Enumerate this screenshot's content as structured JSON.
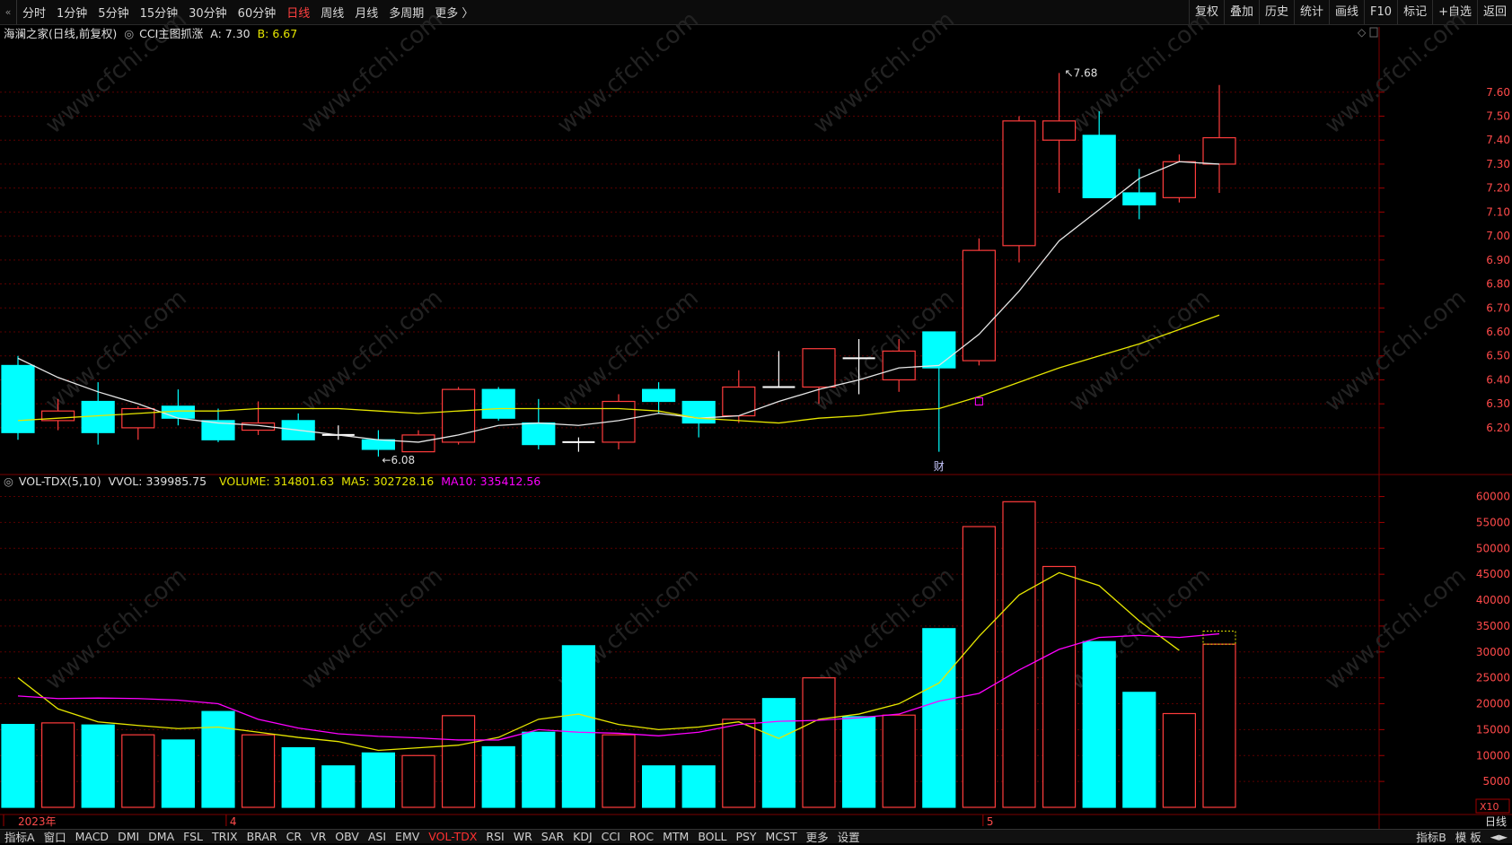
{
  "toolbar": {
    "collapse_icon": "double-chevron-icon",
    "periods": [
      "分时",
      "1分钟",
      "5分钟",
      "15分钟",
      "30分钟",
      "60分钟",
      "日线",
      "周线",
      "月线",
      "多周期",
      "更多 〉"
    ],
    "active_period": "日线",
    "right_tools": [
      "复权",
      "叠加",
      "历史",
      "统计",
      "画线",
      "F10",
      "标记",
      "+自选",
      "返回"
    ]
  },
  "main_info": {
    "stock": "海澜之家(日线,前复权)",
    "indicator": "CCI主图抓涨",
    "a_label": "A: 7.30",
    "b_label": "B: 6.67"
  },
  "vol_info": {
    "name": "VOL-TDX(5,10)",
    "vvol": "VVOL: 339985.75",
    "volume": "VOLUME: 314801.63",
    "ma5": "MA5: 302728.16",
    "ma10": "MA10: 335412.56"
  },
  "colors": {
    "up": "#ff3c3c",
    "down": "#00ffff",
    "ma_white": "#e6e6e6",
    "ma_yellow": "#e6e600",
    "ma10": "#ff00ff",
    "grid": "#5a0000"
  },
  "annotations": {
    "high": "7.68",
    "low": "6.08",
    "fin_marker": "财",
    "scale_tag": "X10"
  },
  "x_labels": [
    "2023年",
    "4",
    "5"
  ],
  "chart_data": {
    "type": "candlestick",
    "price_ylim": [
      6.02,
      7.76
    ],
    "price_ticks": [
      6.2,
      6.3,
      6.4,
      6.5,
      6.6,
      6.7,
      6.8,
      6.9,
      7.0,
      7.1,
      7.2,
      7.3,
      7.4,
      7.5,
      7.6
    ],
    "vol_ylim": [
      0,
      62000
    ],
    "vol_ticks": [
      5000,
      10000,
      15000,
      20000,
      25000,
      30000,
      35000,
      40000,
      45000,
      50000,
      55000,
      60000
    ],
    "candles": [
      {
        "o": 6.46,
        "h": 6.5,
        "l": 6.15,
        "c": 6.18,
        "v": 16000
      },
      {
        "o": 6.23,
        "h": 6.32,
        "l": 6.19,
        "c": 6.27,
        "v": 16300
      },
      {
        "o": 6.31,
        "h": 6.39,
        "l": 6.13,
        "c": 6.18,
        "v": 15900
      },
      {
        "o": 6.2,
        "h": 6.29,
        "l": 6.15,
        "c": 6.28,
        "v": 14000
      },
      {
        "o": 6.29,
        "h": 6.36,
        "l": 6.21,
        "c": 6.24,
        "v": 13000
      },
      {
        "o": 6.23,
        "h": 6.28,
        "l": 6.14,
        "c": 6.15,
        "v": 18500
      },
      {
        "o": 6.19,
        "h": 6.31,
        "l": 6.17,
        "c": 6.22,
        "v": 14000
      },
      {
        "o": 6.23,
        "h": 6.26,
        "l": 6.15,
        "c": 6.15,
        "v": 11500
      },
      {
        "o": 6.17,
        "h": 6.21,
        "l": 6.15,
        "c": 6.17,
        "v": 8000
      },
      {
        "o": 6.15,
        "h": 6.19,
        "l": 6.08,
        "c": 6.11,
        "v": 10500
      },
      {
        "o": 6.1,
        "h": 6.19,
        "l": 6.1,
        "c": 6.17,
        "v": 10000
      },
      {
        "o": 6.14,
        "h": 6.37,
        "l": 6.13,
        "c": 6.36,
        "v": 17700
      },
      {
        "o": 6.36,
        "h": 6.37,
        "l": 6.23,
        "c": 6.24,
        "v": 11700
      },
      {
        "o": 6.22,
        "h": 6.32,
        "l": 6.11,
        "c": 6.13,
        "v": 14500
      },
      {
        "o": 6.14,
        "h": 6.16,
        "l": 6.1,
        "c": 6.14,
        "v": 31200
      },
      {
        "o": 6.14,
        "h": 6.34,
        "l": 6.11,
        "c": 6.31,
        "v": 14000
      },
      {
        "o": 6.36,
        "h": 6.39,
        "l": 6.26,
        "c": 6.31,
        "v": 8000
      },
      {
        "o": 6.31,
        "h": 6.31,
        "l": 6.16,
        "c": 6.22,
        "v": 8000
      },
      {
        "o": 6.25,
        "h": 6.44,
        "l": 6.22,
        "c": 6.37,
        "v": 17000
      },
      {
        "o": 6.37,
        "h": 6.52,
        "l": 6.37,
        "c": 6.37,
        "v": 21000
      },
      {
        "o": 6.37,
        "h": 6.53,
        "l": 6.3,
        "c": 6.53,
        "v": 25000
      },
      {
        "o": 6.49,
        "h": 6.57,
        "l": 6.34,
        "c": 6.49,
        "v": 17500
      },
      {
        "o": 6.4,
        "h": 6.57,
        "l": 6.35,
        "c": 6.52,
        "v": 17800
      },
      {
        "o": 6.6,
        "h": 6.6,
        "l": 6.1,
        "c": 6.45,
        "v": 34500
      },
      {
        "o": 6.48,
        "h": 6.99,
        "l": 6.46,
        "c": 6.94,
        "v": 54200
      },
      {
        "o": 6.96,
        "h": 7.5,
        "l": 6.89,
        "c": 7.48,
        "v": 59000
      },
      {
        "o": 7.4,
        "h": 7.68,
        "l": 7.18,
        "c": 7.48,
        "v": 46500
      },
      {
        "o": 7.42,
        "h": 7.52,
        "l": 7.16,
        "c": 7.16,
        "v": 32000
      },
      {
        "o": 7.18,
        "h": 7.28,
        "l": 7.07,
        "c": 7.13,
        "v": 22200
      },
      {
        "o": 7.16,
        "h": 7.34,
        "l": 7.14,
        "c": 7.31,
        "v": 18100
      },
      {
        "o": 7.3,
        "h": 7.63,
        "l": 7.18,
        "c": 7.41,
        "v": 31500
      }
    ],
    "ma_short": [
      6.49,
      6.41,
      6.35,
      6.3,
      6.24,
      6.22,
      6.21,
      6.19,
      6.17,
      6.15,
      6.14,
      6.17,
      6.21,
      6.22,
      6.21,
      6.23,
      6.26,
      6.24,
      6.25,
      6.31,
      6.36,
      6.4,
      6.45,
      6.46,
      6.59,
      6.77,
      6.98,
      7.11,
      7.24,
      7.31,
      7.3
    ],
    "ma_long": [
      6.23,
      6.24,
      6.25,
      6.26,
      6.27,
      6.27,
      6.28,
      6.28,
      6.28,
      6.27,
      6.26,
      6.27,
      6.28,
      6.28,
      6.28,
      6.28,
      6.27,
      6.24,
      6.23,
      6.22,
      6.24,
      6.25,
      6.27,
      6.28,
      6.33,
      6.39,
      6.45,
      6.5,
      6.55,
      6.61,
      6.67
    ],
    "vol_ma5": [
      25000,
      19000,
      16500,
      15800,
      15200,
      15500,
      14500,
      13500,
      12700,
      11000,
      11500,
      12000,
      13500,
      17000,
      18000,
      16000,
      15000,
      15500,
      16500,
      13300,
      17000,
      18000,
      20000,
      24000,
      33000,
      41000,
      45300,
      42800,
      36000,
      30300
    ],
    "vol_ma10": [
      21500,
      21000,
      21100,
      21000,
      20700,
      20000,
      17000,
      15300,
      14200,
      13700,
      13400,
      13000,
      13000,
      15000,
      14500,
      14300,
      13800,
      14500,
      16000,
      16600,
      16800,
      17300,
      18000,
      20500,
      22000,
      26500,
      30500,
      32800,
      33200,
      32800,
      33500
    ]
  }
}
